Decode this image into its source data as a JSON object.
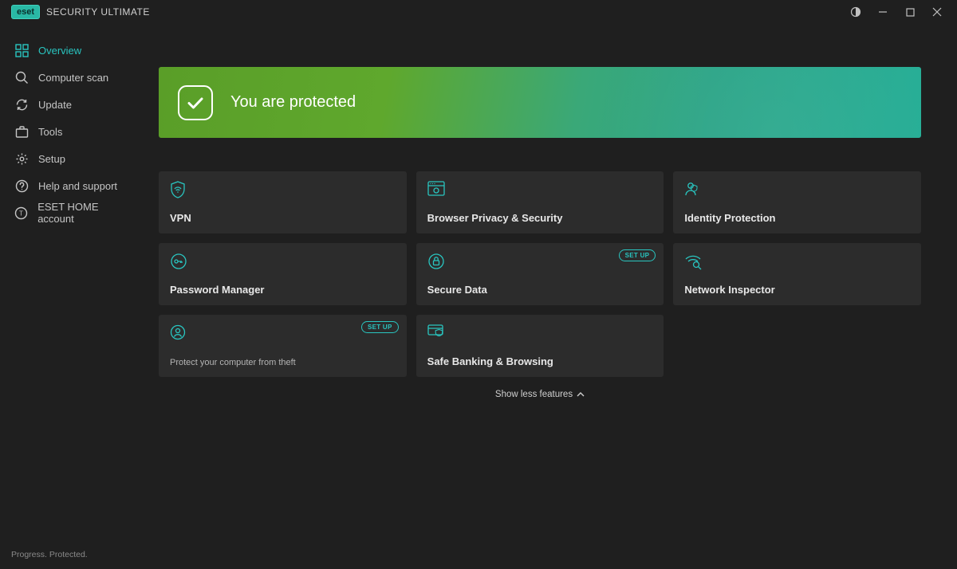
{
  "titlebar": {
    "logo": "eset",
    "product": "SECURITY ULTIMATE"
  },
  "sidebar": {
    "items": [
      {
        "label": "Overview",
        "icon": "overview-icon",
        "active": true
      },
      {
        "label": "Computer scan",
        "icon": "search-icon",
        "active": false
      },
      {
        "label": "Update",
        "icon": "refresh-icon",
        "active": false
      },
      {
        "label": "Tools",
        "icon": "briefcase-icon",
        "active": false
      },
      {
        "label": "Setup",
        "icon": "gear-icon",
        "active": false
      },
      {
        "label": "Help and support",
        "icon": "help-icon",
        "active": false
      },
      {
        "label": "ESET HOME account",
        "icon": "account-icon",
        "active": false
      }
    ]
  },
  "banner": {
    "text": "You are protected"
  },
  "features": [
    {
      "title": "VPN",
      "icon": "shield-wifi-icon",
      "setup": false,
      "subtitle": null
    },
    {
      "title": "Browser Privacy & Security",
      "icon": "browser-icon",
      "setup": false,
      "subtitle": null
    },
    {
      "title": "Identity Protection",
      "icon": "identity-icon",
      "setup": false,
      "subtitle": null
    },
    {
      "title": "Password Manager",
      "icon": "padlock-key-icon",
      "setup": false,
      "subtitle": null
    },
    {
      "title": "Secure Data",
      "icon": "padlock-icon",
      "setup": true,
      "subtitle": null
    },
    {
      "title": "Network Inspector",
      "icon": "wifi-search-icon",
      "setup": false,
      "subtitle": null
    },
    {
      "title": null,
      "icon": "person-pin-icon",
      "setup": true,
      "subtitle": "Protect your computer from theft"
    },
    {
      "title": "Safe Banking & Browsing",
      "icon": "card-shield-icon",
      "setup": false,
      "subtitle": null
    }
  ],
  "toggle_label": "Show less features",
  "setup_badge_label": "SET UP",
  "tagline": "Progress. Protected."
}
